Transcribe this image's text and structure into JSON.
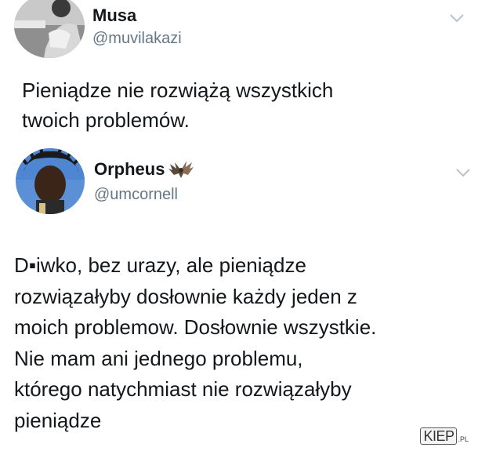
{
  "tweet1": {
    "display_name": "Musa",
    "handle": "@muvilakazi",
    "text_line1": "Pieniądze nie rozwiążą wszystkich",
    "text_line2": "twoich problemów.",
    "menu_icon": "chevron-down-icon"
  },
  "tweet2": {
    "display_name": "Orpheus",
    "name_emoji": "bat-icon",
    "handle": "@umcornell",
    "text_lines": [
      "D▪iwko, bez urazy, ale pieniądze",
      "rozwiązałyby dosłownie każdy jeden z",
      "moich problemow. Dosłownie wszystkie.",
      "Nie mam ani jednego problemu,",
      "którego natychmiast nie rozwiązałyby",
      "pieniądze"
    ],
    "menu_icon": "chevron-down-icon"
  },
  "watermark": {
    "main": "KIEP",
    "suffix": ".PL"
  },
  "colors": {
    "text": "#14171a",
    "handle": "#657786",
    "chevron": "#b8c2cc"
  }
}
